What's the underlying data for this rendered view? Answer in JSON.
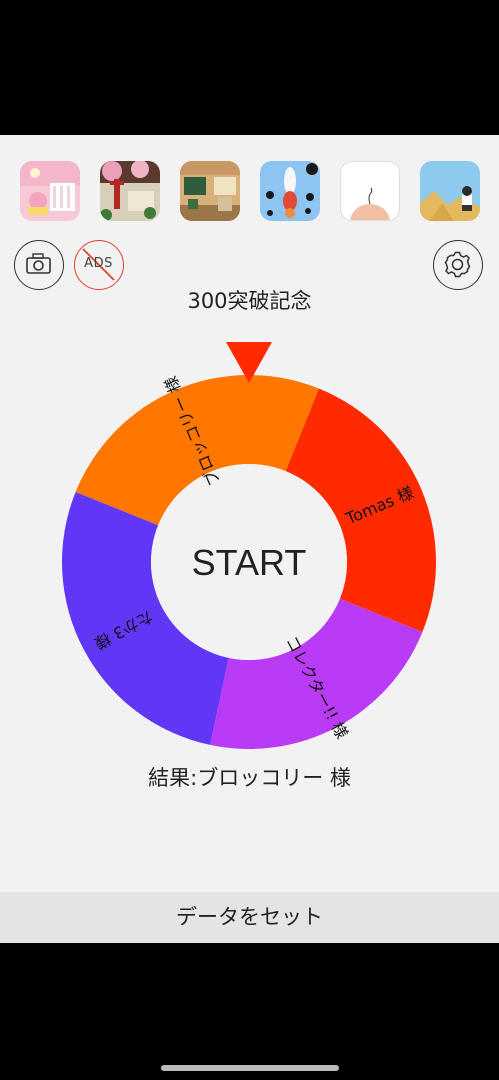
{
  "thumbnails": [
    {
      "name": "game-thumb-pink-room",
      "color": "#f7c9d6"
    },
    {
      "name": "game-thumb-japanese-garden",
      "color": "#c9c2b0"
    },
    {
      "name": "game-thumb-classroom",
      "color": "#d9b07a"
    },
    {
      "name": "game-thumb-rocket",
      "color": "#8dc4f2"
    },
    {
      "name": "game-thumb-bald-head",
      "color": "#ffffff"
    },
    {
      "name": "game-thumb-desert",
      "color": "#8ec9ee"
    }
  ],
  "buttons": {
    "ads_label": "ADS"
  },
  "icons": {
    "camera": "camera-icon",
    "no_ads": "no-ads-icon",
    "settings": "gear-icon"
  },
  "title": "300突破記念",
  "wheel": {
    "center_label": "START",
    "segments": [
      {
        "label": "ブロッコリー 様",
        "color": "#ff7700",
        "share": 0.2
      },
      {
        "label": "Tomas 様",
        "color": "#ff2a00",
        "share": 0.2
      },
      {
        "label": "コレクター!! 様",
        "color": "#b93bf5",
        "share": 0.2
      },
      {
        "label": "たか3 様",
        "color": "#6236f7",
        "share": 0.2
      }
    ],
    "pointer_color": "#ff2a00"
  },
  "result": "結果:ブロッコリー 様",
  "bottom_button": "データをセット"
}
